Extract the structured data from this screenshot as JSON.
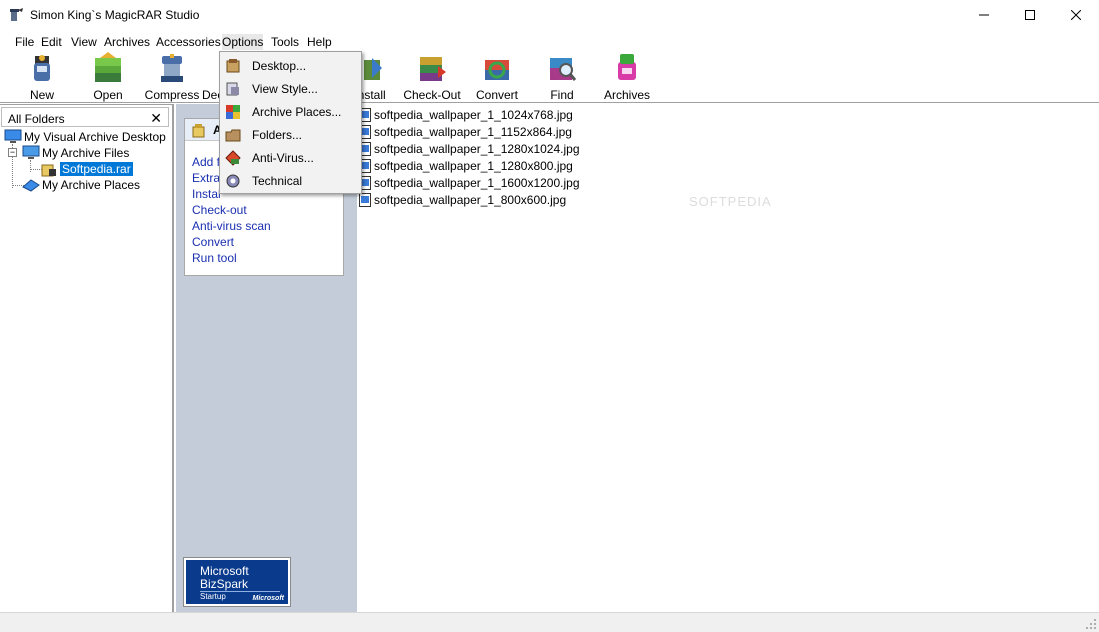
{
  "window": {
    "title": "Simon King`s MagicRAR Studio"
  },
  "menu": {
    "items": [
      "File",
      "Edit",
      "View",
      "Archives",
      "Accessories",
      "Options",
      "Tools",
      "Help"
    ],
    "open_item": "Options"
  },
  "toolbar": {
    "buttons": [
      "New",
      "Open",
      "Compress",
      "Decompress",
      "Install",
      "Check-Out",
      "Convert",
      "Find",
      "Archives"
    ]
  },
  "options_menu": {
    "items": [
      "Desktop...",
      "View Style...",
      "Archive Places...",
      "Folders...",
      "Anti-Virus...",
      "Technical"
    ]
  },
  "left_pane": {
    "title": "All Folders",
    "close_glyph": "✕",
    "tree": [
      {
        "label": "My Visual Archive Desktop",
        "level": 0
      },
      {
        "label": "My Archive Files",
        "level": 1
      },
      {
        "label": "Softpedia.rar",
        "level": 2,
        "selected": true
      },
      {
        "label": "My Archive Places",
        "level": 1
      }
    ]
  },
  "task_pane": {
    "header_visible": "A",
    "links": [
      "Add f",
      "Extra",
      "Instal",
      "Check-out",
      "Anti-virus scan",
      "Convert",
      "Run tool"
    ],
    "badge": {
      "line1": "Microsoft",
      "line2": "BizSpark",
      "line3": "Startup",
      "line4": "Microsoft"
    }
  },
  "file_list": {
    "files": [
      "softpedia_wallpaper_1_1024x768.jpg",
      "softpedia_wallpaper_1_1152x864.jpg",
      "softpedia_wallpaper_1_1280x1024.jpg",
      "softpedia_wallpaper_1_1280x800.jpg",
      "softpedia_wallpaper_1_1600x1200.jpg",
      "softpedia_wallpaper_1_800x600.jpg"
    ],
    "watermark": "SOFTPEDIA"
  },
  "colors": {
    "selection": "#0078d7",
    "link": "#1a2fb0",
    "task_bg": "#c3ccd8"
  }
}
